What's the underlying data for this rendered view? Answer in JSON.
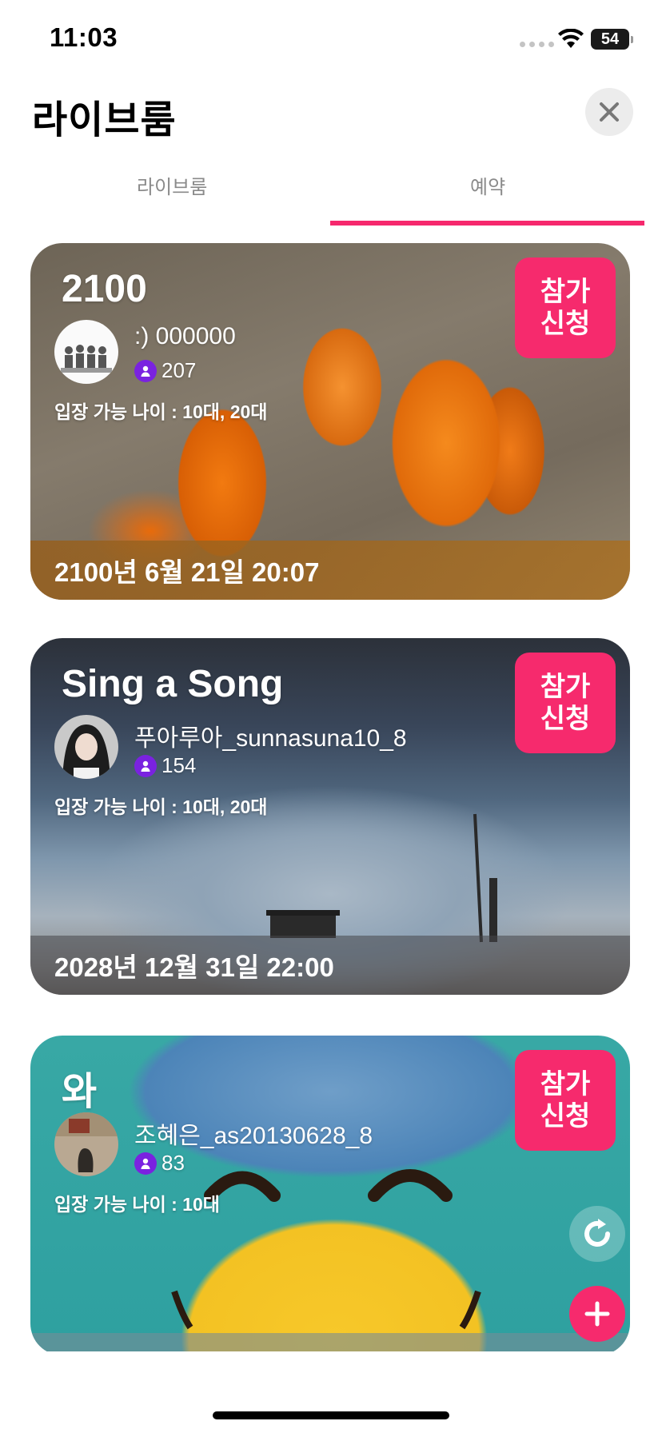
{
  "status_bar": {
    "time": "11:03",
    "battery": "54"
  },
  "header": {
    "title": "라이브룸"
  },
  "tabs": [
    {
      "label": "라이브룸",
      "active": false
    },
    {
      "label": "예약",
      "active": true
    }
  ],
  "colors": {
    "accent": "#f62a6d",
    "badge": "#7a22e0"
  },
  "rooms": [
    {
      "title": "2100",
      "join_label_line1": "참가",
      "join_label_line2": "신청",
      "host": ":) 000000",
      "count": "207",
      "age": "입장 가능 나이 : 10대, 20대",
      "date": "2100년 6월 21일 20:07"
    },
    {
      "title": "Sing a Song",
      "join_label_line1": "참가",
      "join_label_line2": "신청",
      "host": "푸아루아_sunnasuna10_8",
      "count": "154",
      "age": "입장 가능 나이 : 10대, 20대",
      "date": "2028년 12월 31일 22:00"
    },
    {
      "title": "와",
      "join_label_line1": "참가",
      "join_label_line2": "신청",
      "host": "조혜은_as20130628_8",
      "count": "83",
      "age": "입장 가능 나이 : 10대"
    }
  ],
  "icons": {
    "close": "close-icon",
    "refresh": "refresh-icon",
    "add": "plus-icon",
    "user": "user-icon"
  }
}
